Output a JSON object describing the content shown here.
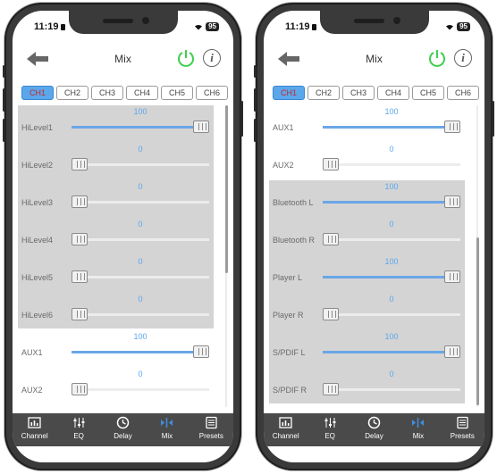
{
  "header": {
    "title": "Mix"
  },
  "status": {
    "time": "11:19",
    "battery": "95"
  },
  "tabs": [
    "CH1",
    "CH2",
    "CH3",
    "CH4",
    "CH5",
    "CH6"
  ],
  "nav": [
    {
      "label": "Channel",
      "icon": "channel-icon"
    },
    {
      "label": "EQ",
      "icon": "eq-icon"
    },
    {
      "label": "Delay",
      "icon": "delay-icon"
    },
    {
      "label": "Mix",
      "icon": "mix-icon"
    },
    {
      "label": "Presets",
      "icon": "presets-icon"
    }
  ],
  "colors": {
    "accent": "#5ba7ec",
    "active_tab_text": "#c62828",
    "nav_active": "#3f8fe0",
    "power": "#3ecf4e"
  },
  "screens": [
    {
      "active_tab": 0,
      "active_nav": 3,
      "rows": [
        {
          "label": "HiLevel1",
          "value": "100",
          "level": 1.0
        },
        {
          "label": "HiLevel2",
          "value": "0",
          "level": 0
        },
        {
          "label": "HiLevel3",
          "value": "0",
          "level": 0
        },
        {
          "label": "HiLevel4",
          "value": "0",
          "level": 0
        },
        {
          "label": "HiLevel5",
          "value": "0",
          "level": 0
        },
        {
          "label": "HiLevel6",
          "value": "0",
          "level": 0
        },
        {
          "label": "AUX1",
          "value": "100",
          "level": 1.0
        },
        {
          "label": "AUX2",
          "value": "0",
          "level": 0
        }
      ]
    },
    {
      "active_tab": 0,
      "active_nav": 3,
      "rows": [
        {
          "label": "AUX1",
          "value": "100",
          "level": 1.0
        },
        {
          "label": "AUX2",
          "value": "0",
          "level": 0
        },
        {
          "label": "Bluetooth L",
          "value": "100",
          "level": 1.0
        },
        {
          "label": "Bluetooth R",
          "value": "0",
          "level": 0
        },
        {
          "label": "Player L",
          "value": "100",
          "level": 1.0
        },
        {
          "label": "Player R",
          "value": "0",
          "level": 0
        },
        {
          "label": "S/PDIF L",
          "value": "100",
          "level": 1.0
        },
        {
          "label": "S/PDIF R",
          "value": "0",
          "level": 0
        }
      ]
    }
  ]
}
